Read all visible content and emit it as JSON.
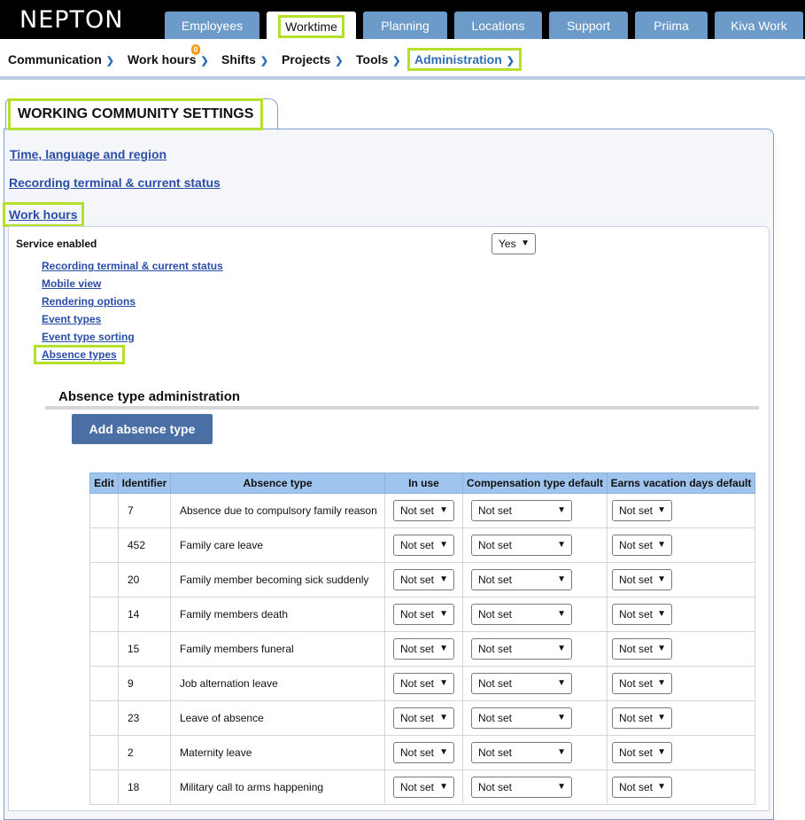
{
  "app": {
    "logo": "NEPTON"
  },
  "top_tabs": [
    {
      "label": "Employees"
    },
    {
      "label": "Worktime"
    },
    {
      "label": "Planning"
    },
    {
      "label": "Locations"
    },
    {
      "label": "Support"
    },
    {
      "label": "Priima"
    },
    {
      "label": "Kiva Work"
    }
  ],
  "nav": {
    "items": [
      {
        "label": "Communication"
      },
      {
        "label": "Work hours",
        "badge": "0"
      },
      {
        "label": "Shifts"
      },
      {
        "label": "Projects"
      },
      {
        "label": "Tools"
      },
      {
        "label": "Administration"
      }
    ]
  },
  "settings": {
    "title": "WORKING COMMUNITY SETTINGS",
    "links": [
      {
        "label": "Time, language and region"
      },
      {
        "label": "Recording terminal & current status"
      },
      {
        "label": "Work hours"
      }
    ],
    "service_enabled_label": "Service enabled",
    "service_enabled_value": "Yes",
    "sub_links": [
      {
        "label": "Recording terminal & current status"
      },
      {
        "label": "Mobile view"
      },
      {
        "label": "Rendering options"
      },
      {
        "label": "Event types"
      },
      {
        "label": "Event type sorting"
      },
      {
        "label": "Absence types"
      }
    ]
  },
  "absence_admin": {
    "title": "Absence type administration",
    "add_button": "Add absence type",
    "columns": [
      "Edit",
      "Identifier",
      "Absence type",
      "In use",
      "Compensation type default",
      "Earns vacation days default"
    ],
    "rows": [
      {
        "id": "7",
        "name": "Absence due to compulsory family reason",
        "in_use": "Not set",
        "comp": "Not set",
        "vac": "Not set"
      },
      {
        "id": "452",
        "name": "Family care leave",
        "in_use": "Not set",
        "comp": "Not set",
        "vac": "Not set"
      },
      {
        "id": "20",
        "name": "Family member becoming sick suddenly",
        "in_use": "Not set",
        "comp": "Not set",
        "vac": "Not set"
      },
      {
        "id": "14",
        "name": "Family members death",
        "in_use": "Not set",
        "comp": "Not set",
        "vac": "Not set"
      },
      {
        "id": "15",
        "name": "Family members funeral",
        "in_use": "Not set",
        "comp": "Not set",
        "vac": "Not set"
      },
      {
        "id": "9",
        "name": "Job alternation leave",
        "in_use": "Not set",
        "comp": "Not set",
        "vac": "Not set"
      },
      {
        "id": "23",
        "name": "Leave of absence",
        "in_use": "Not set",
        "comp": "Not set",
        "vac": "Not set"
      },
      {
        "id": "2",
        "name": "Maternity leave",
        "in_use": "Not set",
        "comp": "Not set",
        "vac": "Not set"
      },
      {
        "id": "18",
        "name": "Military call to arms happening",
        "in_use": "Not set",
        "comp": "Not set",
        "vac": "Not set"
      }
    ]
  },
  "colors": {
    "accent_highlight": "#b3e12b",
    "tab_blue": "#6c9bc9",
    "link_blue": "#2a4ea6",
    "button_blue": "#4a6fa5",
    "table_header": "#9fc4ee"
  },
  "icons": {
    "dropdown": "chevron-down-icon"
  }
}
